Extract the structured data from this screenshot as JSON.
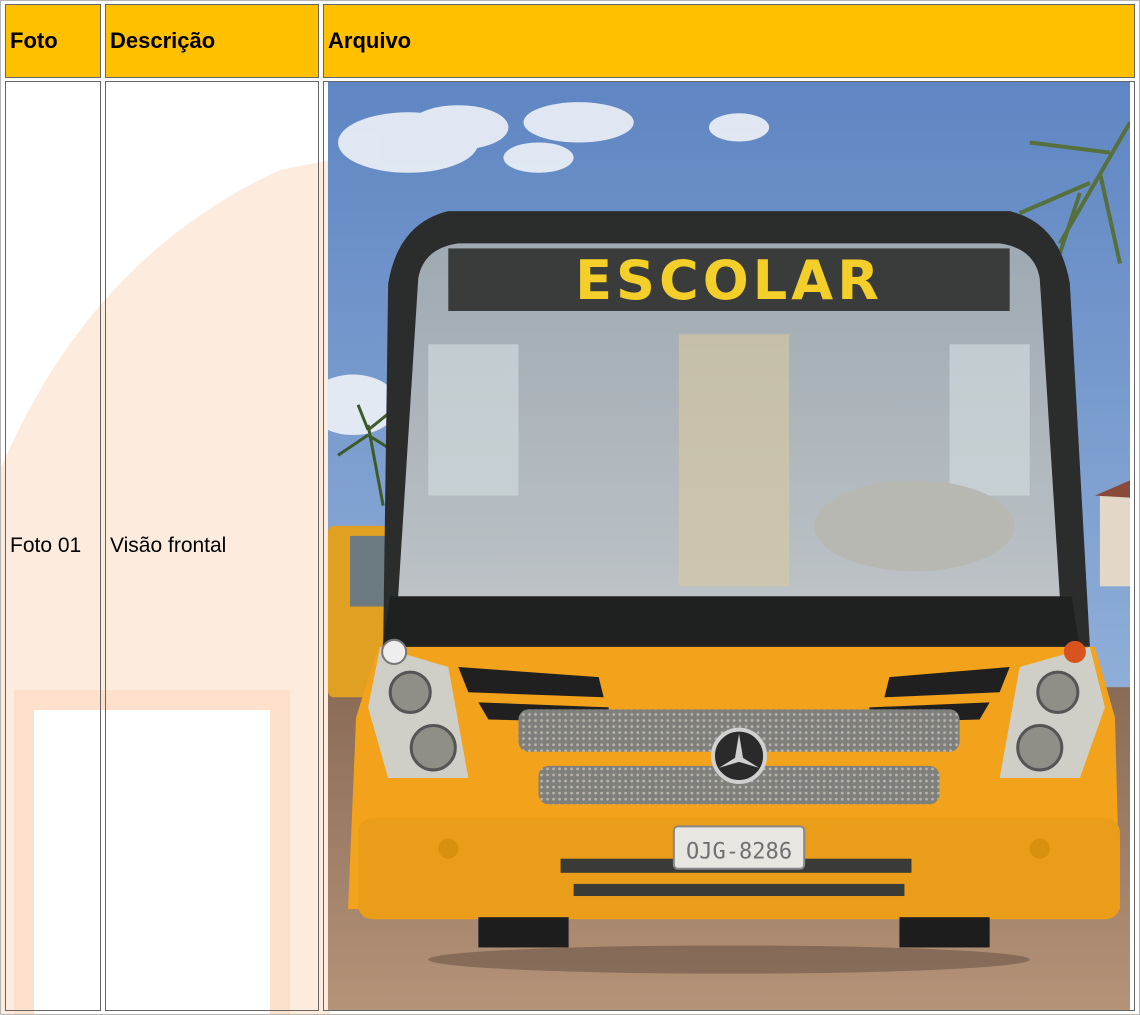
{
  "table": {
    "headers": [
      "Foto",
      "Descrição",
      "Arquivo"
    ],
    "rows": [
      {
        "foto": "Foto 01",
        "descricao": "Visão frontal",
        "arquivo": {
          "sign_text": "ESCOLAR",
          "plate_text": "OJG-8286"
        }
      }
    ]
  },
  "colors": {
    "header_bg": "#ffc000",
    "watermark": "#fde3cf",
    "bus_body": "#f2a21b",
    "sign_text": "#f4cf2a"
  }
}
